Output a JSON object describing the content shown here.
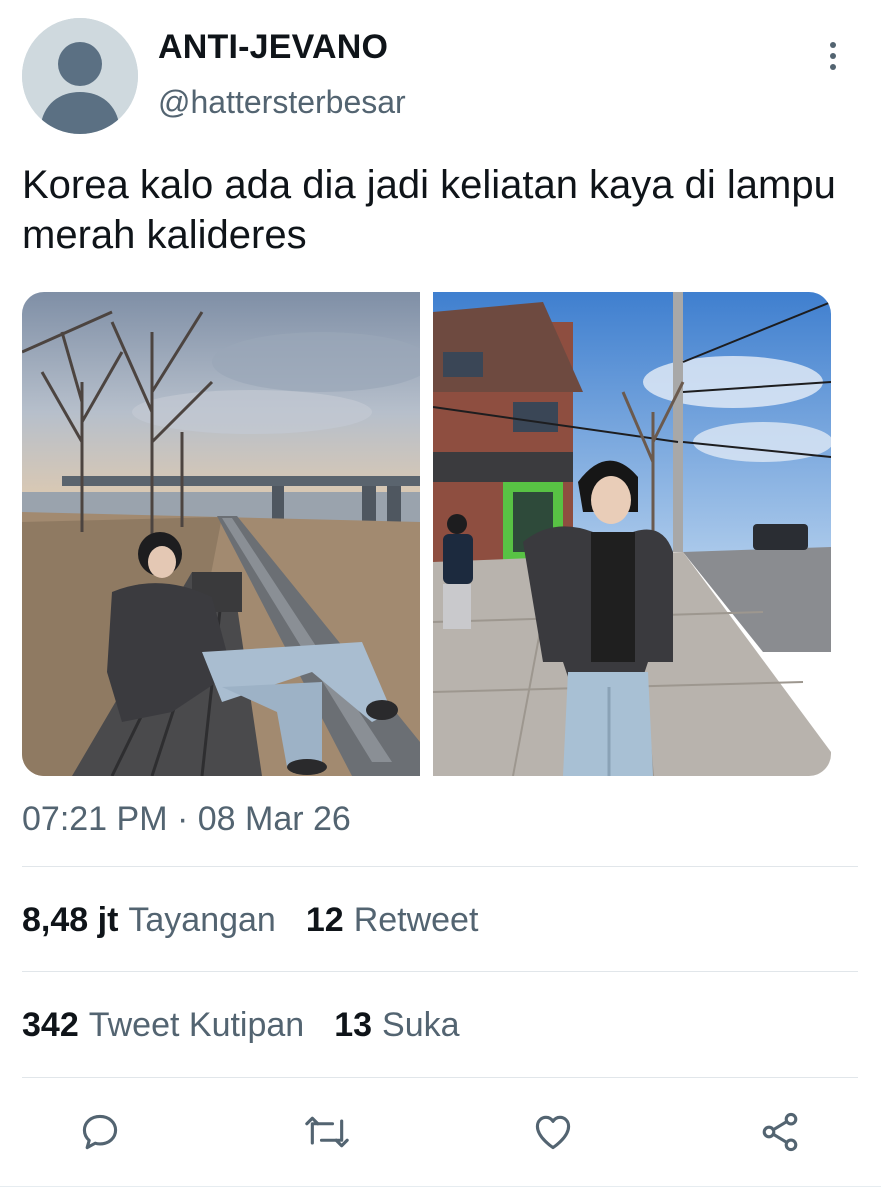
{
  "author": {
    "display_name": "ANTI-JEVANO",
    "handle": "@hattersterbesar"
  },
  "tweet": {
    "text": "Korea kalo ada dia jadi keliatan kaya di lampu merah kalideres",
    "timestamp": "07:21 PM · 08 Mar 26"
  },
  "media": [
    {
      "icon": "photo-park-bench"
    },
    {
      "icon": "photo-street-sidewalk"
    }
  ],
  "stats": {
    "views_count": "8,48 jt",
    "views_label": "Tayangan",
    "retweets_count": "12",
    "retweets_label": "Retweet",
    "quotes_count": "342",
    "quotes_label": "Tweet Kutipan",
    "likes_count": "13",
    "likes_label": "Suka"
  },
  "actions": [
    "reply-icon",
    "retweet-icon",
    "like-icon",
    "share-icon"
  ],
  "colors": {
    "primary_text": "#0f1419",
    "secondary_text": "#536471",
    "divider": "#e1e6ea",
    "avatar_bg": "#cfd9de"
  }
}
